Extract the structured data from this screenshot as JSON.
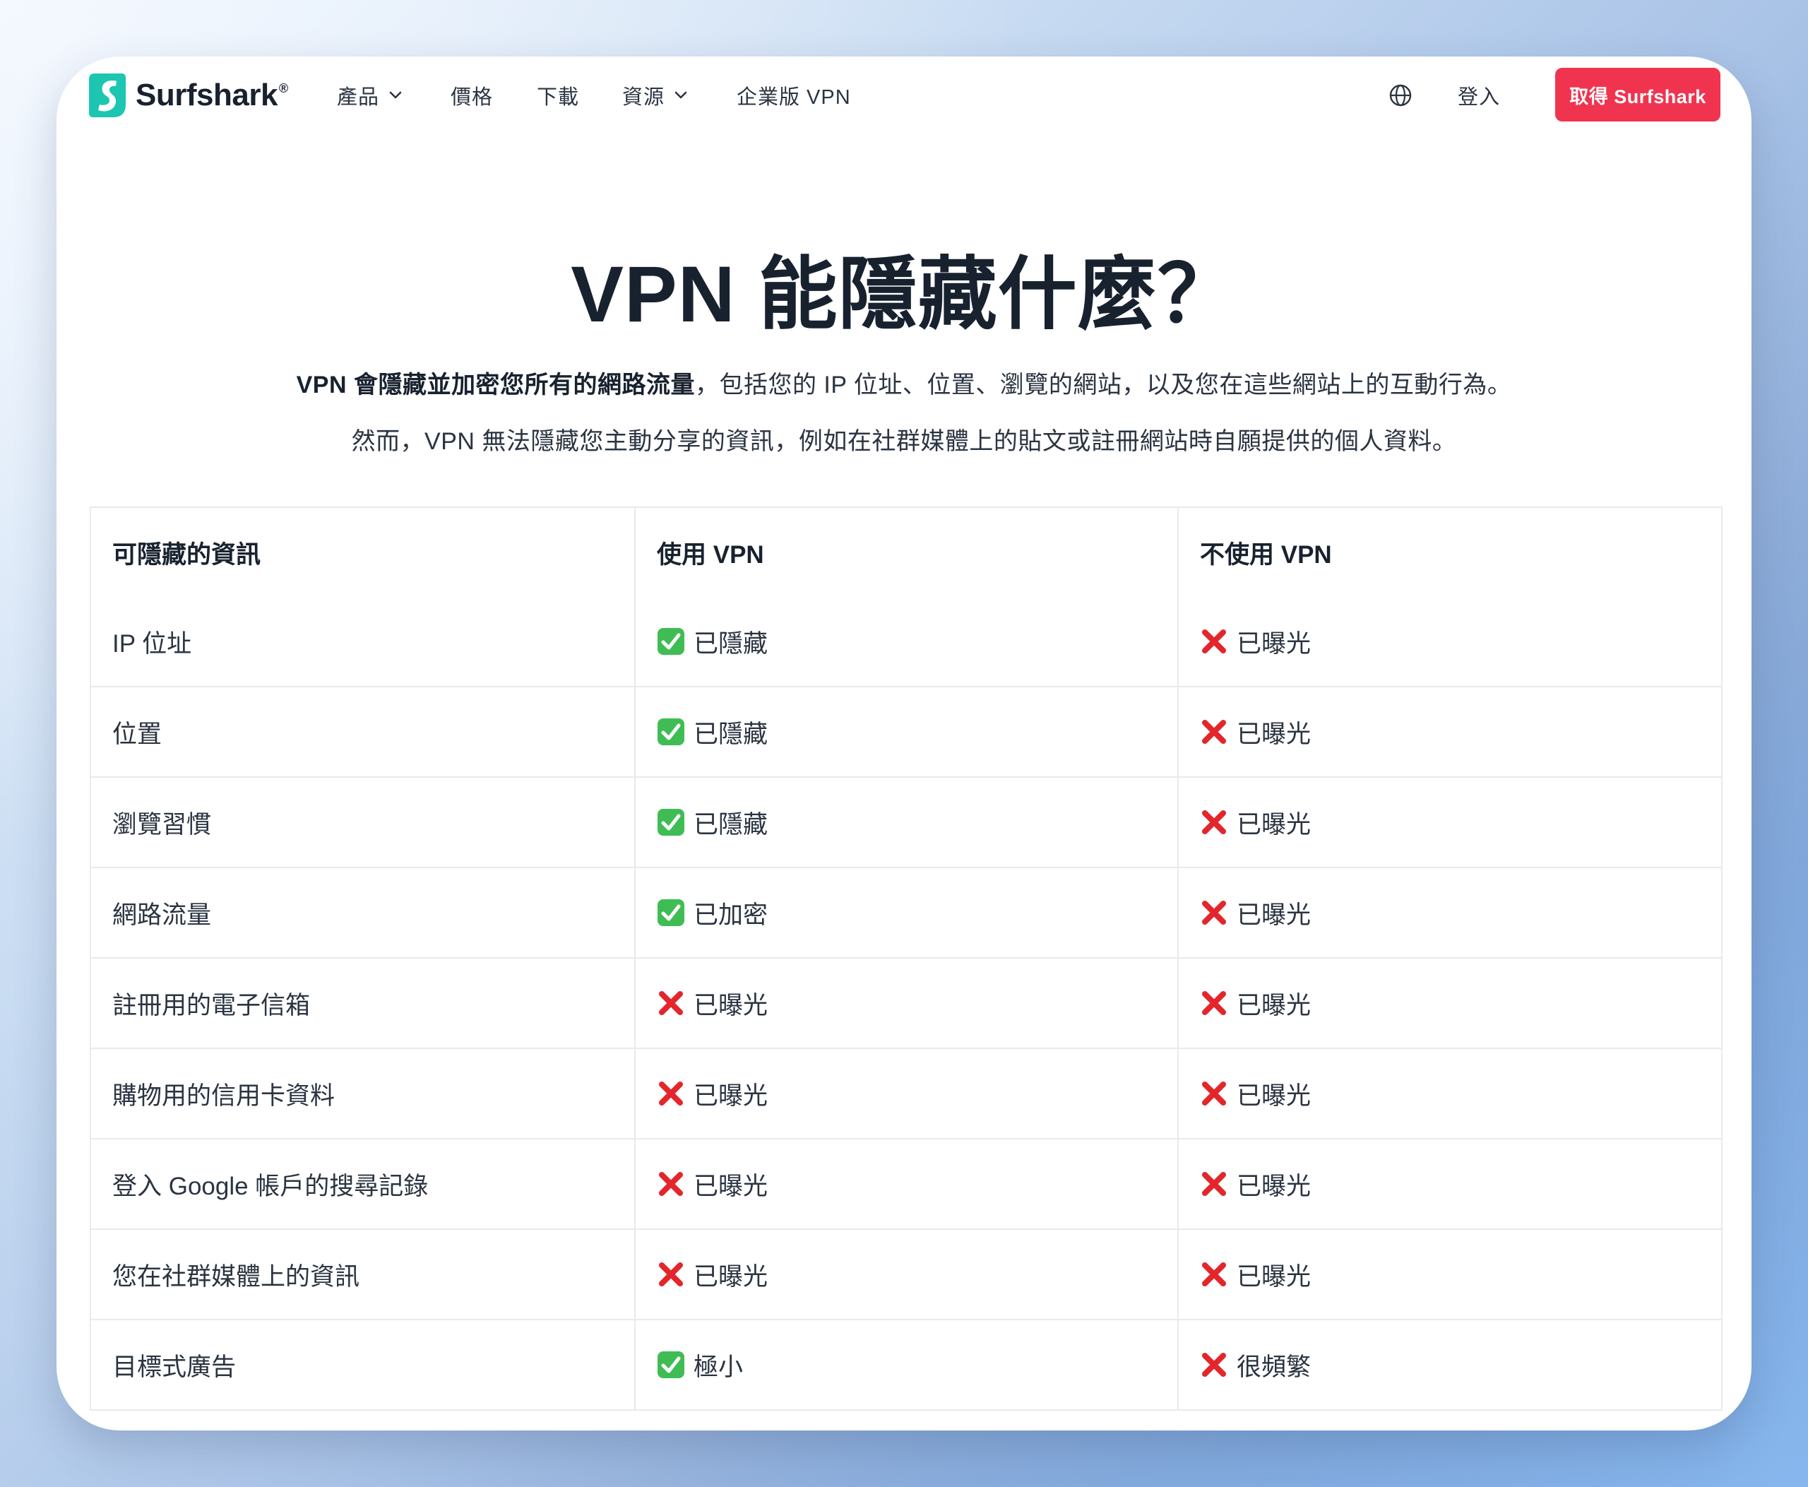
{
  "nav": {
    "brand": "Surfshark",
    "brand_mark": "®",
    "items": [
      {
        "label": "產品",
        "dropdown": true
      },
      {
        "label": "價格",
        "dropdown": false
      },
      {
        "label": "下載",
        "dropdown": false
      },
      {
        "label": "資源",
        "dropdown": true
      },
      {
        "label": "企業版 VPN",
        "dropdown": false
      }
    ],
    "globe_icon": "globe-icon",
    "login_label": "登入",
    "cta_label": "取得 Surfshark"
  },
  "colors": {
    "accent": "#f0344f",
    "brand_teal": "#1cc6b0",
    "check_green": "#3fbd54",
    "cross_red": "#e3262c",
    "text_dark": "#18222f"
  },
  "hero": {
    "title": "VPN 能隱藏什麼？",
    "lead_bold": "VPN 會隱藏並加密您所有的網路流量",
    "lead_rest": "，包括您的 IP 位址、位置、瀏覽的網站，以及您在這些網站上的互動行為。",
    "note": "然而，VPN 無法隱藏您主動分享的資訊，例如在社群媒體上的貼文或註冊網站時自願提供的個人資料。"
  },
  "table": {
    "headers": [
      "可隱藏的資訊",
      "使用 VPN",
      "不使用 VPN"
    ],
    "rows": [
      {
        "item": "IP 位址",
        "vpn": {
          "icon": "check-icon",
          "text": "已隱藏"
        },
        "novpn": {
          "icon": "cross-icon",
          "text": "已曝光"
        }
      },
      {
        "item": "位置",
        "vpn": {
          "icon": "check-icon",
          "text": "已隱藏"
        },
        "novpn": {
          "icon": "cross-icon",
          "text": "已曝光"
        }
      },
      {
        "item": "瀏覽習慣",
        "vpn": {
          "icon": "check-icon",
          "text": "已隱藏"
        },
        "novpn": {
          "icon": "cross-icon",
          "text": "已曝光"
        }
      },
      {
        "item": "網路流量",
        "vpn": {
          "icon": "check-icon",
          "text": "已加密"
        },
        "novpn": {
          "icon": "cross-icon",
          "text": "已曝光"
        }
      },
      {
        "item": "註冊用的電子信箱",
        "vpn": {
          "icon": "cross-icon",
          "text": "已曝光"
        },
        "novpn": {
          "icon": "cross-icon",
          "text": "已曝光"
        }
      },
      {
        "item": "購物用的信用卡資料",
        "vpn": {
          "icon": "cross-icon",
          "text": "已曝光"
        },
        "novpn": {
          "icon": "cross-icon",
          "text": "已曝光"
        }
      },
      {
        "item": "登入 Google 帳戶的搜尋記錄",
        "vpn": {
          "icon": "cross-icon",
          "text": "已曝光"
        },
        "novpn": {
          "icon": "cross-icon",
          "text": "已曝光"
        }
      },
      {
        "item": "您在社群媒體上的資訊",
        "vpn": {
          "icon": "cross-icon",
          "text": "已曝光"
        },
        "novpn": {
          "icon": "cross-icon",
          "text": "已曝光"
        }
      },
      {
        "item": "目標式廣告",
        "vpn": {
          "icon": "check-icon",
          "text": "極小"
        },
        "novpn": {
          "icon": "cross-icon",
          "text": "很頻繁"
        }
      }
    ]
  }
}
